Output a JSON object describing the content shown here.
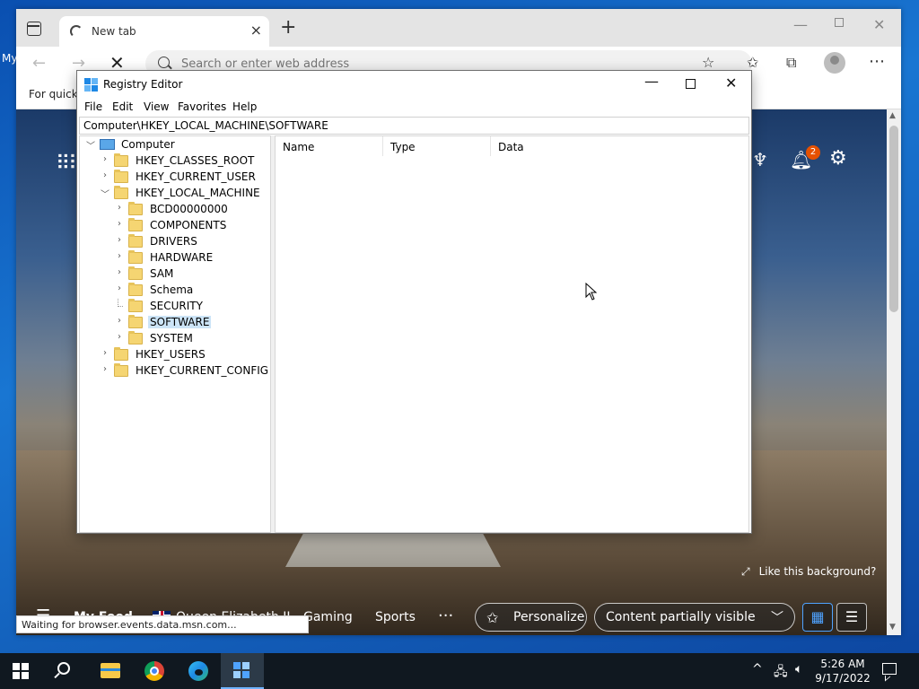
{
  "desktop": {
    "edge_label": "My"
  },
  "browser": {
    "tab": {
      "title": "New tab"
    },
    "address": {
      "placeholder": "Search or enter web address"
    },
    "favorites_label": "For quick",
    "status": "Waiting for browser.events.data.msn.com...",
    "ntp": {
      "notification_count": "2",
      "like_background": "Like this background?",
      "feed": {
        "my_feed": "My Feed",
        "topic": "Queen Elizabeth II",
        "gaming": "Gaming",
        "sports": "Sports",
        "more": "···",
        "personalize": "Personalize",
        "content_visibility": "Content partially visible"
      }
    }
  },
  "regedit": {
    "title": "Registry Editor",
    "menu": [
      "File",
      "Edit",
      "View",
      "Favorites",
      "Help"
    ],
    "path": "Computer\\HKEY_LOCAL_MACHINE\\SOFTWARE",
    "tree": {
      "root": "Computer",
      "hives": [
        "HKEY_CLASSES_ROOT",
        "HKEY_CURRENT_USER",
        "HKEY_LOCAL_MACHINE"
      ],
      "hklm_children": [
        "BCD00000000",
        "COMPONENTS",
        "DRIVERS",
        "HARDWARE",
        "SAM",
        "Schema",
        "SECURITY",
        "SOFTWARE",
        "SYSTEM"
      ],
      "hives_after": [
        "HKEY_USERS",
        "HKEY_CURRENT_CONFIG"
      ],
      "selected": "SOFTWARE"
    },
    "columns": [
      "Name",
      "Type",
      "Data"
    ]
  },
  "taskbar": {
    "time": "5:26 AM",
    "date": "9/17/2022"
  },
  "colors": {
    "accent": "#0078d4",
    "selection": "#cce4f7",
    "taskbar": "#101820"
  },
  "icons": [
    "tab-actions-icon",
    "loading-spinner-icon",
    "close-icon",
    "plus-icon",
    "back-arrow-icon",
    "forward-arrow-icon",
    "stop-icon",
    "search-icon",
    "add-favorite-icon",
    "favorites-icon",
    "collections-icon",
    "profile-icon",
    "more-icon",
    "apps-grid-icon",
    "rewards-icon",
    "bell-icon",
    "gear-icon",
    "registry-icon",
    "folder-icon",
    "computer-icon",
    "windows-start-icon",
    "file-explorer-icon",
    "chrome-icon",
    "edge-icon",
    "network-icon",
    "volume-icon",
    "notification-icon"
  ]
}
